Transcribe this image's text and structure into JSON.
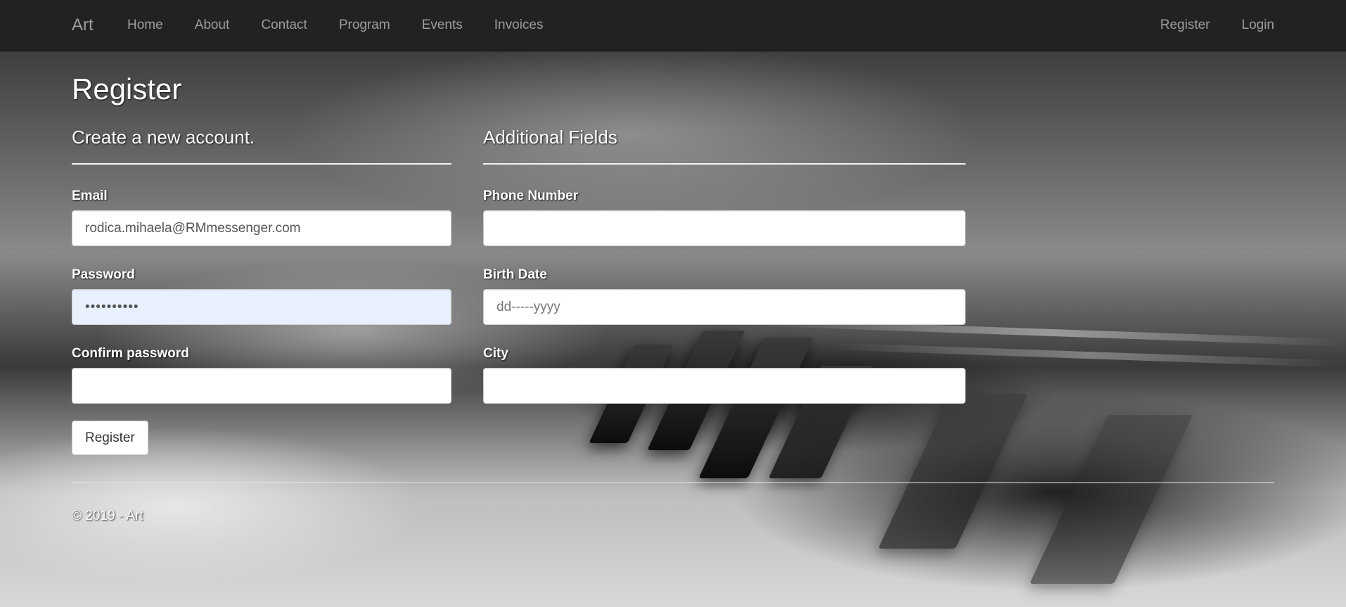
{
  "nav": {
    "brand": "Art",
    "links": [
      "Home",
      "About",
      "Contact",
      "Program",
      "Events",
      "Invoices"
    ],
    "right_links": [
      "Register",
      "Login"
    ]
  },
  "page": {
    "title": "Register"
  },
  "left_form": {
    "subtitle": "Create a new account.",
    "email_label": "Email",
    "email_value": "rodica.mihaela@RMmessenger.com",
    "password_label": "Password",
    "password_value": "••••••••••",
    "confirm_label": "Confirm password",
    "confirm_value": "",
    "submit_label": "Register"
  },
  "right_form": {
    "subtitle": "Additional Fields",
    "phone_label": "Phone Number",
    "phone_value": "",
    "birth_label": "Birth Date",
    "birth_placeholder": "dd-----yyyy",
    "city_label": "City",
    "city_value": ""
  },
  "footer": {
    "text": "© 2019 - Art"
  },
  "colors": {
    "navbar_bg": "#222222",
    "nav_text": "#9d9d9d",
    "autofill_bg": "#e8f0fe"
  }
}
